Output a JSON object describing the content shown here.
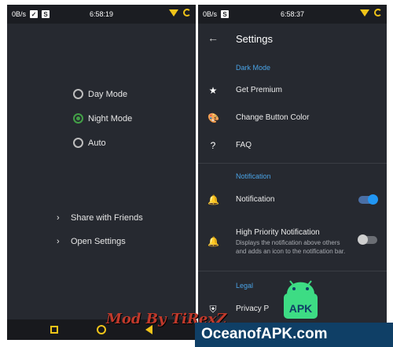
{
  "left_phone": {
    "status": {
      "speed": "0B/s",
      "time": "6:58:19"
    },
    "options": [
      {
        "label": "Day Mode",
        "selected": false
      },
      {
        "label": "Night Mode",
        "selected": true
      },
      {
        "label": "Auto",
        "selected": false
      }
    ],
    "links": [
      {
        "label": "Share with Friends"
      },
      {
        "label": "Open Settings"
      }
    ]
  },
  "right_phone": {
    "status": {
      "speed": "0B/s",
      "time": "6:58:37"
    },
    "title": "Settings",
    "sections": {
      "dark_mode": "Dark Mode",
      "notification": "Notification",
      "legal": "Legal"
    },
    "rows": {
      "premium": "Get Premium",
      "button_color": "Change Button Color",
      "faq": "FAQ",
      "notification": "Notification",
      "privacy": "Privacy P"
    },
    "toggles": {
      "notification_on": true,
      "high_priority_on": false
    },
    "high_priority": {
      "title": "High Priority Notification",
      "desc": "Displays the notification above others and adds an icon to the notification bar."
    }
  },
  "overlay": {
    "mod_text": "Mod By TiRexZ",
    "apk_label": "APK",
    "watermark": "OceanofAPK.com"
  },
  "colors": {
    "accent_blue": "#2196f3",
    "radio_green": "#43a047",
    "nav_yellow": "#f0c419",
    "bg": "#262930"
  }
}
